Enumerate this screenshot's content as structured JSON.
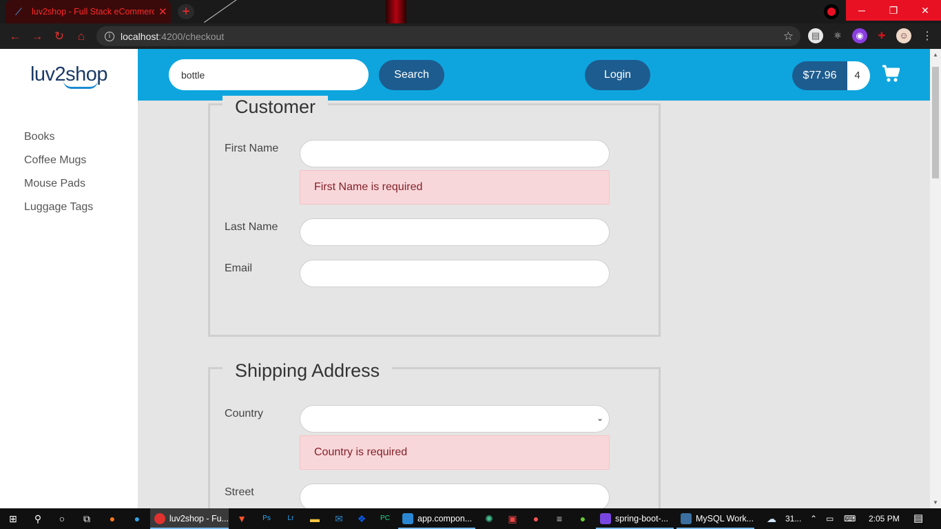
{
  "browser": {
    "tab_title": "luv2shop - Full Stack eCommerce",
    "url_host": "localhost",
    "url_path": ":4200/checkout"
  },
  "brand": {
    "logo_text": "luv2shop"
  },
  "sidebar": {
    "items": [
      {
        "label": "Books"
      },
      {
        "label": "Coffee Mugs"
      },
      {
        "label": "Mouse Pads"
      },
      {
        "label": "Luggage Tags"
      }
    ]
  },
  "header": {
    "search_value": "bottle",
    "search_button": "Search",
    "login_button": "Login",
    "cart_total": "$77.96",
    "cart_quantity": "4"
  },
  "customer": {
    "legend": "Customer",
    "first_name_label": "First Name",
    "first_name_value": "",
    "first_name_error": "First Name is required",
    "last_name_label": "Last Name",
    "last_name_value": "",
    "email_label": "Email",
    "email_value": ""
  },
  "shipping": {
    "legend": "Shipping Address",
    "country_label": "Country",
    "country_selected": "",
    "country_error": "Country is required",
    "street_label": "Street",
    "street_value": ""
  },
  "taskbar": {
    "apps": [
      {
        "label": "luv2shop - Fu..."
      },
      {
        "label": "app.compon..."
      },
      {
        "label": "spring-boot-..."
      },
      {
        "label": "MySQL Work..."
      }
    ],
    "weather": "31...",
    "time": "2:05 PM"
  },
  "colors": {
    "header_bg": "#0ea5de",
    "button_bg": "#1d5c8f",
    "alert_bg": "#f8d7da",
    "alert_text": "#842029"
  }
}
